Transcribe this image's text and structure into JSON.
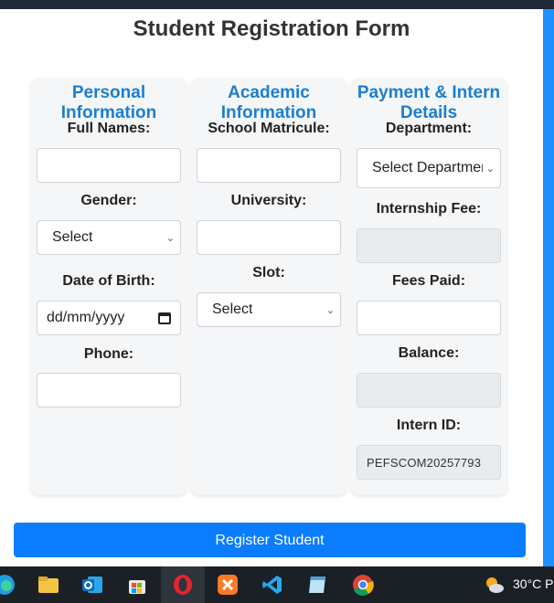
{
  "form": {
    "title": "Student Registration Form",
    "personal": {
      "heading": "Personal Information",
      "full_names_label": "Full Names:",
      "gender_label": "Gender:",
      "gender_value": "Select",
      "dob_label": "Date of Birth:",
      "dob_placeholder": "dd/mm/yyyy",
      "phone_label": "Phone:"
    },
    "academic": {
      "heading": "Academic Information",
      "matricule_label": "School Matricule:",
      "university_label": "University:",
      "slot_label": "Slot:",
      "slot_value": "Select"
    },
    "payment": {
      "heading": "Payment & Intern Details",
      "department_label": "Department:",
      "department_value": "Select Department",
      "fee_label": "Internship Fee:",
      "paid_label": "Fees Paid:",
      "balance_label": "Balance:",
      "intern_id_label": "Intern ID:",
      "intern_id_value": "PEFSCOM20257793"
    },
    "register_label": "Register Student"
  },
  "taskbar": {
    "temperature": "30°C P",
    "icons": [
      "edge-icon",
      "file-explorer-icon",
      "outlook-icon",
      "store-icon",
      "opera-icon",
      "xampp-icon",
      "vscode-icon",
      "notepad-icon",
      "chrome-icon",
      "weather-icon"
    ]
  },
  "colors": {
    "heading_blue": "#1a7fd0",
    "button_blue": "#0a7cff",
    "card_bg": "#f5f6f7",
    "readonly_bg": "#e9ecef"
  }
}
